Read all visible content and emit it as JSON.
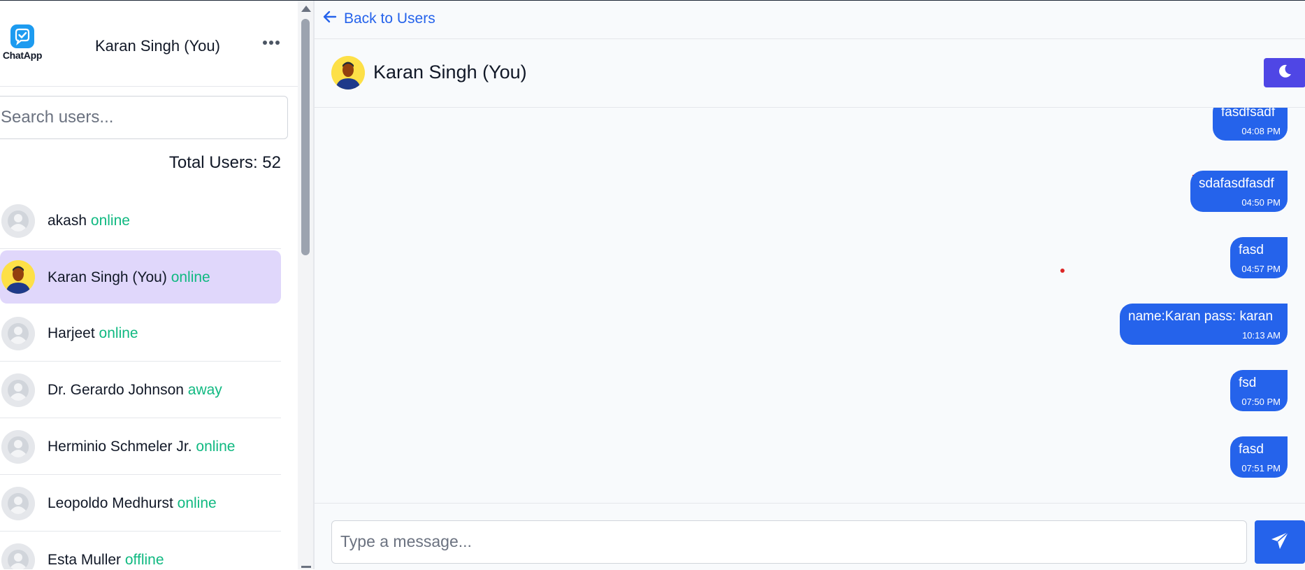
{
  "app": {
    "logo_label": "ChatApp"
  },
  "sidebar": {
    "title": "Karan Singh (You)",
    "search_placeholder": "Search users...",
    "total_users": "Total Users: 52",
    "users": [
      {
        "name": "akash",
        "status": "online",
        "avatar": "default-avatar-icon"
      },
      {
        "name": "Karan Singh (You)",
        "status": "online",
        "avatar": "user-photo",
        "selected": true
      },
      {
        "name": "Harjeet",
        "status": "online",
        "avatar": "default-avatar-icon"
      },
      {
        "name": "Dr. Gerardo Johnson",
        "status": "away",
        "avatar": "default-avatar-icon"
      },
      {
        "name": "Herminio Schmeler Jr.",
        "status": "online",
        "avatar": "default-avatar-icon"
      },
      {
        "name": "Leopoldo Medhurst",
        "status": "online",
        "avatar": "default-avatar-icon"
      },
      {
        "name": "Esta Muller",
        "status": "offline",
        "avatar": "default-avatar-icon"
      }
    ]
  },
  "chat": {
    "back_label": "Back to Users",
    "title": "Karan Singh (You)",
    "theme_toggle_icon": "moon-icon",
    "messages": [
      {
        "text": "fasdfsadf",
        "time": "04:08 PM"
      },
      {
        "text": "sdafasdfasdf",
        "time": "04:50 PM"
      },
      {
        "text": "fasd",
        "time": "04:57 PM"
      },
      {
        "text": "name:Karan pass: karan",
        "time": "10:13 AM"
      },
      {
        "text": "fsd",
        "time": "07:50 PM"
      },
      {
        "text": "fasd",
        "time": "07:51 PM"
      }
    ],
    "input_placeholder": "Type a message...",
    "send_icon": "send-icon"
  },
  "colors": {
    "primary": "#2563eb",
    "status_text": "#10b981",
    "selected_row": "#e0d7fb",
    "theme_button": "#4f46e5",
    "delete_icon": "#dc2626"
  }
}
